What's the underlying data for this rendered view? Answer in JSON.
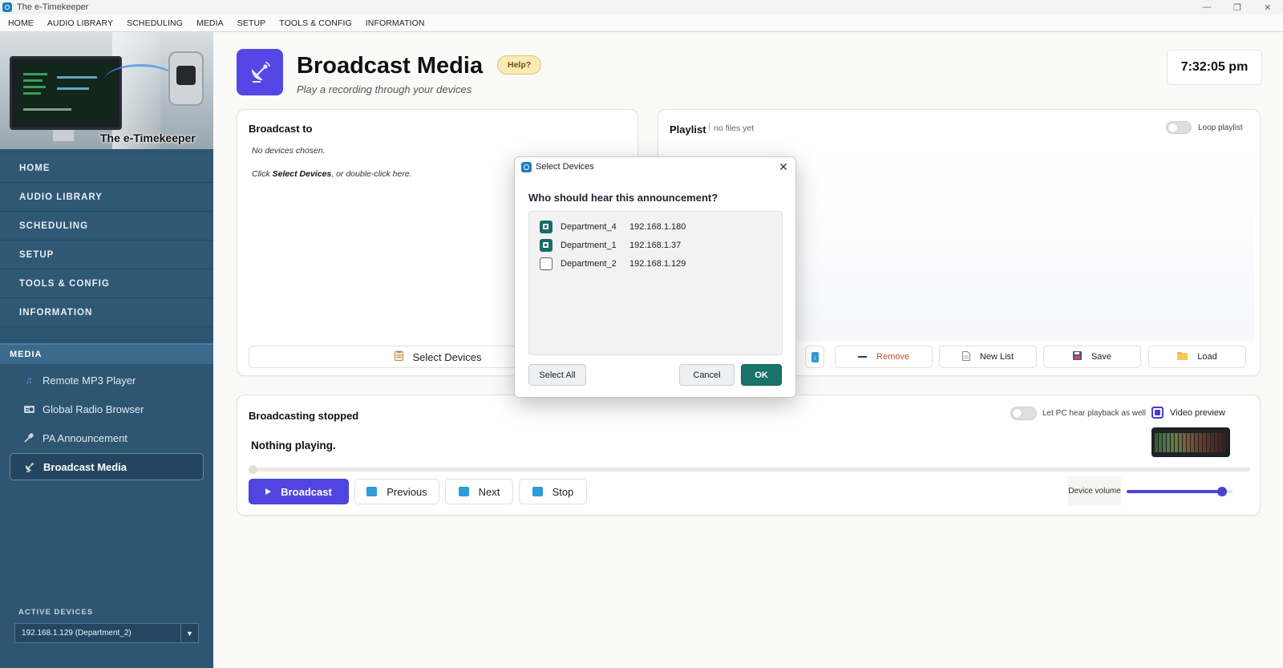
{
  "window": {
    "title": "The e-Timekeeper",
    "controls": [
      "—",
      "❐",
      "✕"
    ]
  },
  "menubar": [
    "HOME",
    "AUDIO LIBRARY",
    "SCHEDULING",
    "MEDIA",
    "SETUP",
    "TOOLS & CONFIG",
    "INFORMATION"
  ],
  "sidebar": {
    "hero_caption": "The e-Timekeeper",
    "nav": [
      "HOME",
      "AUDIO LIBRARY",
      "SCHEDULING",
      "SETUP",
      "TOOLS & CONFIG",
      "INFORMATION"
    ],
    "section": "MEDIA",
    "sub_items": [
      {
        "label": "Remote MP3 Player",
        "icon": "music-note-icon"
      },
      {
        "label": "Global Radio Browser",
        "icon": "radio-icon"
      },
      {
        "label": "PA Announcement",
        "icon": "microphone-icon"
      },
      {
        "label": "Broadcast Media",
        "icon": "satellite-dish-icon",
        "active": true
      }
    ],
    "active_devices_label": "ACTIVE DEVICES",
    "active_device_value": "192.168.1.129  (Department_2)"
  },
  "header": {
    "title": "Broadcast Media",
    "help": "Help?",
    "subtitle": "Play a recording through your devices",
    "clock": "7:32:05 pm"
  },
  "broadcast_to": {
    "title": "Broadcast to",
    "line1": "No devices chosen.",
    "line2_prefix": "Click ",
    "line2_bold": "Select Devices",
    "line2_suffix": ", or double-click here.",
    "select_button": "Select Devices"
  },
  "playlist": {
    "title": "Playlist",
    "status": "no files yet",
    "loop_label": "Loop playlist",
    "loop_on": false,
    "buttons": {
      "remove": "Remove",
      "new_list": "New List",
      "save": "Save",
      "load": "Load"
    }
  },
  "player": {
    "status": "Broadcasting stopped",
    "now_playing": "Nothing playing.",
    "pc_hear_label": "Let PC hear playback as well",
    "pc_hear_on": false,
    "video_preview_label": "Video preview",
    "video_preview_checked": true,
    "progress": 0,
    "buttons": {
      "broadcast": "Broadcast",
      "previous": "Previous",
      "next": "Next",
      "stop": "Stop"
    },
    "volume_label": "Device volume",
    "volume": 0.9
  },
  "dialog": {
    "title": "Select Devices",
    "question": "Who should hear this announcement?",
    "devices": [
      {
        "name": "Department_4",
        "ip": "192.168.1.180",
        "checked": true
      },
      {
        "name": "Department_1",
        "ip": "192.168.1.37",
        "checked": true
      },
      {
        "name": "Department_2",
        "ip": "192.168.1.129",
        "checked": false
      }
    ],
    "select_all": "Select All",
    "cancel": "Cancel",
    "ok": "OK"
  },
  "colors": {
    "accent": "#5145e1",
    "sidebar": "#2e5571",
    "ok_button": "#18736b",
    "help_badge": "#fbeab3"
  }
}
